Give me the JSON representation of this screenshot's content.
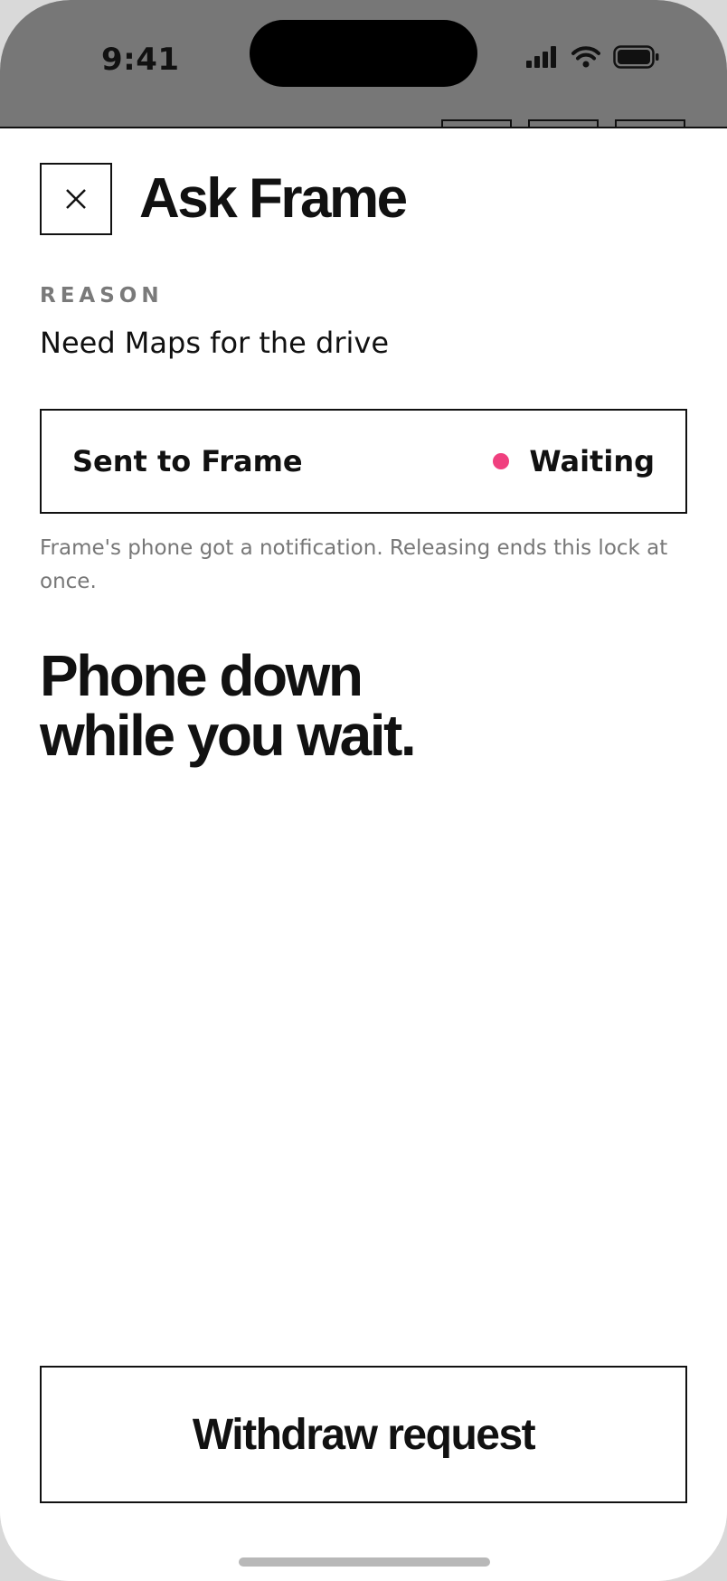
{
  "status_bar": {
    "time": "9:41"
  },
  "header": {
    "close_icon": "close-x-icon",
    "title": "Ask Frame"
  },
  "reason": {
    "label": "REASON",
    "text": "Need Maps for the drive"
  },
  "request_status": {
    "recipient_label": "Sent to Frame",
    "state_label": "Waiting",
    "state_color": "#f0407f"
  },
  "note": "Frame's phone got a notification. Releasing ends this lock at once.",
  "headline": {
    "line1": "Phone down",
    "line2": "while you wait."
  },
  "actions": {
    "withdraw_label": "Withdraw request"
  },
  "colors": {
    "text": "#111111",
    "muted": "#7a7a7a",
    "backdrop": "#777777",
    "accent": "#f0407f"
  }
}
